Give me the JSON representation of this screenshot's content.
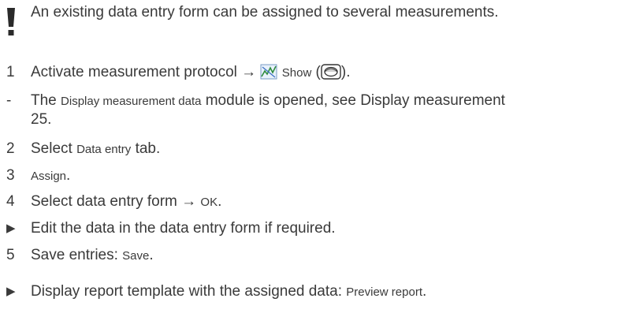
{
  "note": "An existing data entry form can be assigned to several measurements.",
  "steps": [
    {
      "marker": "1",
      "pre": "Activate measurement protocol → ",
      "ui1": "Show",
      "paren_open": " (",
      "paren_close": ")."
    },
    {
      "marker": "-",
      "pre": "The ",
      "ui1": "Display measurement data",
      "post": " module is opened, see Display measurement",
      "cont": "25."
    },
    {
      "marker": "2",
      "pre": "Select ",
      "ui1": "Data entry",
      "post": " tab."
    },
    {
      "marker": "3",
      "ui1": "Assign",
      "post": "."
    },
    {
      "marker": "4",
      "pre": "Select data entry form → ",
      "ui1": "OK",
      "post": "."
    },
    {
      "marker": "▶",
      "pre": "Edit the data in the data entry form if required."
    },
    {
      "marker": "5",
      "pre": "Save entries: ",
      "ui1": "Save",
      "post": "."
    },
    {
      "marker": "▶",
      "pre": "Display report template with the assigned data: ",
      "ui1": "Preview report",
      "post": "."
    }
  ]
}
